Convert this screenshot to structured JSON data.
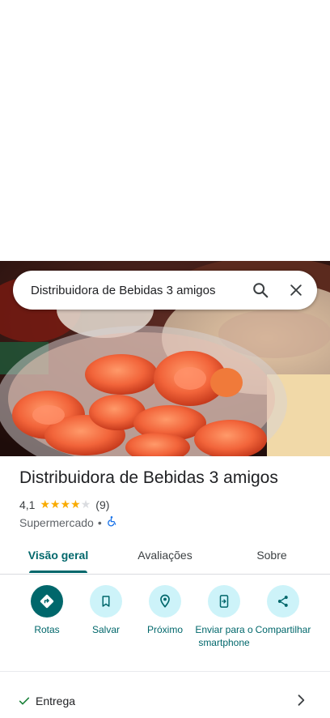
{
  "search": {
    "query": "Distribuidora de Bebidas 3 amigos"
  },
  "place": {
    "name": "Distribuidora de Bebidas 3 amigos",
    "rating": "4,1",
    "stars_value": 4.1,
    "reviews_count": "(9)",
    "category": "Supermercado",
    "separator": "•",
    "accessibility_icon": "wheelchair-icon"
  },
  "tabs": [
    {
      "label": "Visão geral",
      "active": true
    },
    {
      "label": "Avaliações",
      "active": false
    },
    {
      "label": "Sobre",
      "active": false
    }
  ],
  "actions": [
    {
      "label": "Rotas",
      "icon": "directions-icon"
    },
    {
      "label": "Salvar",
      "icon": "bookmark-icon"
    },
    {
      "label": "Próximo",
      "icon": "nearby-icon"
    },
    {
      "label": "Enviar para o smartphone",
      "icon": "send-to-phone-icon"
    },
    {
      "label": "Compartilhar",
      "icon": "share-icon"
    }
  ],
  "services": [
    {
      "label": "Entrega",
      "available": true
    }
  ],
  "colors": {
    "accent": "#00676b",
    "action_bg": "#cdf3f9",
    "star": "#f9ab00"
  }
}
